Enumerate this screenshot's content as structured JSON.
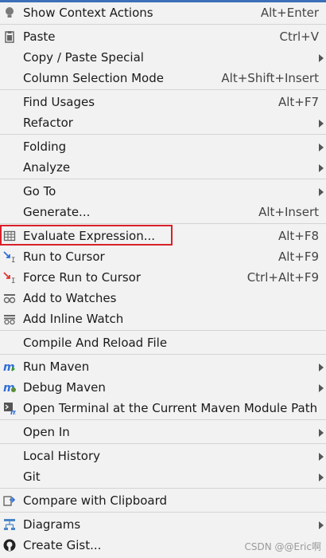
{
  "menu": {
    "items": [
      {
        "label": "Show Context Actions",
        "shortcut": "Alt+Enter",
        "icon": "lightbulb-icon"
      },
      {
        "label": "Paste",
        "shortcut": "Ctrl+V",
        "icon": "paste-icon"
      },
      {
        "label": "Copy / Paste Special",
        "submenu": true
      },
      {
        "label": "Column Selection Mode",
        "shortcut": "Alt+Shift+Insert"
      },
      {
        "label": "Find Usages",
        "shortcut": "Alt+F7"
      },
      {
        "label": "Refactor",
        "submenu": true
      },
      {
        "label": "Folding",
        "submenu": true
      },
      {
        "label": "Analyze",
        "submenu": true
      },
      {
        "label": "Go To",
        "submenu": true
      },
      {
        "label": "Generate...",
        "shortcut": "Alt+Insert"
      },
      {
        "label": "Evaluate Expression...",
        "shortcut": "Alt+F8",
        "icon": "calculator-icon"
      },
      {
        "label": "Run to Cursor",
        "shortcut": "Alt+F9",
        "icon": "run-to-cursor-icon"
      },
      {
        "label": "Force Run to Cursor",
        "shortcut": "Ctrl+Alt+F9",
        "icon": "force-run-to-cursor-icon"
      },
      {
        "label": "Add to Watches",
        "icon": "watches-icon"
      },
      {
        "label": "Add Inline Watch",
        "icon": "inline-watch-icon"
      },
      {
        "label": "Compile And Reload File"
      },
      {
        "label": "Run Maven",
        "submenu": true,
        "icon": "maven-icon"
      },
      {
        "label": "Debug Maven",
        "submenu": true,
        "icon": "maven-debug-icon"
      },
      {
        "label": "Open Terminal at the Current Maven Module Path",
        "icon": "terminal-icon"
      },
      {
        "label": "Open In",
        "submenu": true
      },
      {
        "label": "Local History",
        "submenu": true
      },
      {
        "label": "Git",
        "submenu": true
      },
      {
        "label": "Compare with Clipboard",
        "icon": "compare-icon"
      },
      {
        "label": "Diagrams",
        "submenu": true,
        "icon": "diagram-icon"
      },
      {
        "label": "Create Gist...",
        "icon": "github-icon"
      }
    ]
  },
  "watermark": "CSDN @@Eric啊",
  "colors": {
    "highlight_border": "#d9202a",
    "maven_blue": "#2f6fd6",
    "arrow_red": "#e0342f"
  }
}
